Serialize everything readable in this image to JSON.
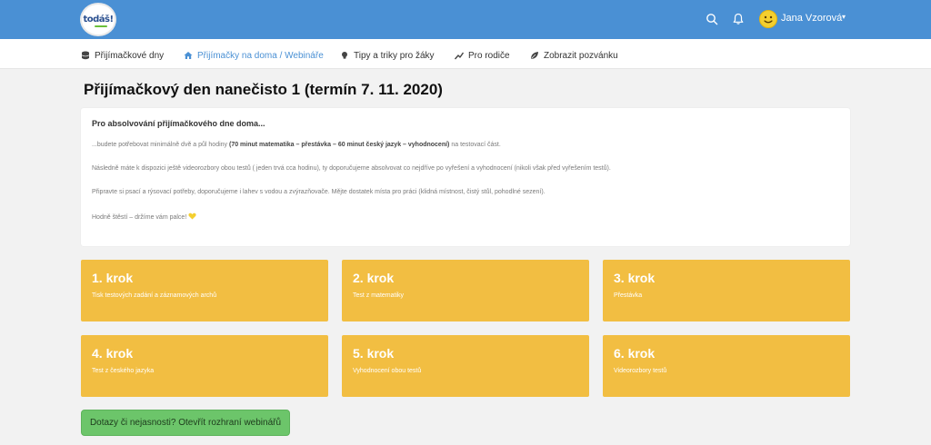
{
  "header": {
    "logo_text": "todáš!",
    "username": "Jana Vzorová"
  },
  "nav": [
    {
      "label": "Přijímačkové dny",
      "icon": "database-icon"
    },
    {
      "label": "Přijímačky na doma / Webináře",
      "icon": "home-icon"
    },
    {
      "label": "Tipy a triky pro žáky",
      "icon": "lightbulb-icon"
    },
    {
      "label": "Pro rodiče",
      "icon": "chart-icon"
    },
    {
      "label": "Zobrazit pozvánku",
      "icon": "leaf-icon"
    }
  ],
  "page": {
    "title": "Přijímačkový den nanečisto 1 (termín 7. 11. 2020)"
  },
  "info": {
    "heading": "Pro absolvování přijímačkového dne doma...",
    "p1_pre": "...budete potřebovat minimálně dvě a půl hodiny ",
    "p1_bold": "(70 minut matematika – přestávka – 60 minut český jazyk – vyhodnocení)",
    "p1_post": " na testovací část.",
    "p2": "Následně máte k dispozici ještě videorozbory obou testů ( jeden trvá cca hodinu), ty doporučujeme absolvovat co nejdříve po vyřešení a vyhodnocení (nikoli však před vyřešením testů).",
    "p3": "Připravte si psací a rýsovací potřeby, doporučujeme i lahev s vodou a zvýrazňovače. Mějte dostatek místa pro práci (klidná místnost, čistý stůl, pohodlné sezení).",
    "p4": "Hodně štěstí – držíme vám palce!"
  },
  "steps": [
    {
      "title": "1. krok",
      "desc": "Tisk testových zadání a záznamových archů"
    },
    {
      "title": "2. krok",
      "desc": "Test z matematiky"
    },
    {
      "title": "3. krok",
      "desc": "Přestávka"
    },
    {
      "title": "4. krok",
      "desc": "Test z českého jazyka"
    },
    {
      "title": "5. krok",
      "desc": "Vyhodnocení obou testů"
    },
    {
      "title": "6. krok",
      "desc": "Videorozbory testů"
    }
  ],
  "cta": {
    "label": "Dotazy či nejasnosti? Otevřít rozhraní webinářů"
  },
  "colors": {
    "topbar": "#4a90d4",
    "step": "#f2be42",
    "cta": "#6cc56a"
  }
}
